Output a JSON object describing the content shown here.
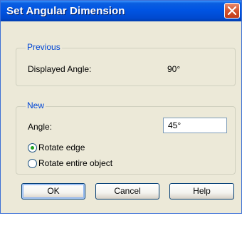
{
  "window": {
    "title": "Set Angular Dimension"
  },
  "previous": {
    "legend": "Previous",
    "displayed_angle_label": "Displayed Angle:",
    "displayed_angle_value": "90°"
  },
  "new": {
    "legend": "New",
    "angle_label": "Angle:",
    "angle_value": "45°",
    "options": [
      {
        "label": "Rotate edge",
        "selected": true
      },
      {
        "label": "Rotate entire object",
        "selected": false
      }
    ]
  },
  "buttons": {
    "ok": "OK",
    "cancel": "Cancel",
    "help": "Help"
  },
  "colors": {
    "titlebar": "#0054e3",
    "dialog_bg": "#ece9d8",
    "group_legend": "#0046d5",
    "close_button": "#d3542f"
  }
}
